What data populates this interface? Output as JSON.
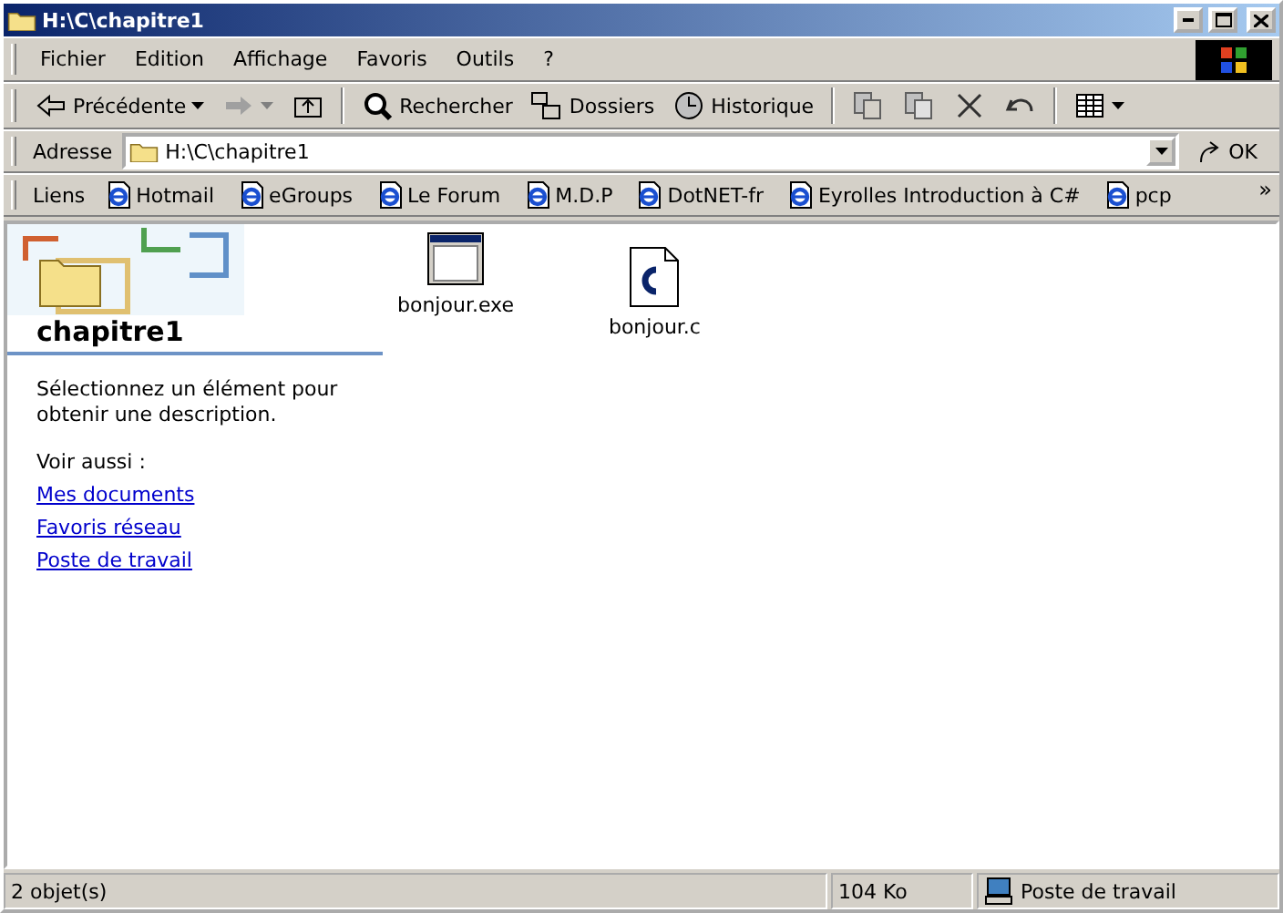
{
  "window": {
    "title": "H:\\C\\chapitre1"
  },
  "menu": [
    "Fichier",
    "Edition",
    "Affichage",
    "Favoris",
    "Outils",
    "?"
  ],
  "toolbar": [
    {
      "kind": "back",
      "label": "Précédente"
    },
    {
      "kind": "forward"
    },
    {
      "kind": "up"
    },
    {
      "kind": "sep"
    },
    {
      "kind": "search",
      "label": "Rechercher"
    },
    {
      "kind": "folders",
      "label": "Dossiers"
    },
    {
      "kind": "history",
      "label": "Historique"
    },
    {
      "kind": "sep"
    },
    {
      "kind": "move"
    },
    {
      "kind": "copy"
    },
    {
      "kind": "delete"
    },
    {
      "kind": "undo"
    },
    {
      "kind": "sep"
    },
    {
      "kind": "views"
    }
  ],
  "address": {
    "label": "Adresse",
    "value": "H:\\C\\chapitre1",
    "go": "OK"
  },
  "links": {
    "label": "Liens",
    "items": [
      "Hotmail",
      "eGroups",
      "Le Forum",
      "M.D.P",
      "DotNET-fr",
      "Eyrolles Introduction à C#",
      "pcp"
    ],
    "more": "»"
  },
  "panel": {
    "title": "chapitre1",
    "description": "Sélectionnez un élément pour obtenir une description.",
    "see_also": "Voir aussi :",
    "links": [
      "Mes documents",
      "Favoris réseau",
      "Poste de travail"
    ]
  },
  "files": [
    {
      "kind": "exe",
      "name": "bonjour.exe"
    },
    {
      "kind": "c",
      "name": "bonjour.c"
    }
  ],
  "status_bar": {
    "objects": "2 objet(s)",
    "size": "104 Ko",
    "zone": "Poste de travail"
  }
}
